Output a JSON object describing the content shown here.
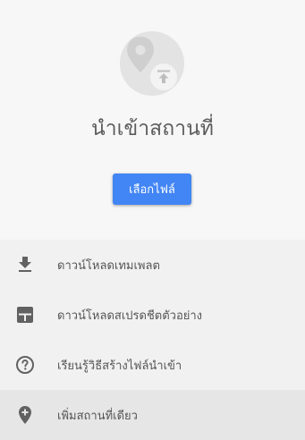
{
  "hero": {
    "illustration_icon": "map-pin-upload-illustration",
    "title": "นำเข้าสถานที่",
    "choose_file_label": "เลือกไฟล์",
    "button_color": "#4285f4"
  },
  "menu": {
    "items": [
      {
        "label": "ดาวน์โหลดเทมเพลต",
        "icon": "download-icon"
      },
      {
        "label": "ดาวน์โหลดสเปรดชีตตัวอย่าง",
        "icon": "spreadsheet-icon"
      },
      {
        "label": "เรียนรู้วิธีสร้างไฟล์นำเข้า",
        "icon": "help-circle-icon"
      },
      {
        "label": "เพิ่มสถานที่เดียว",
        "icon": "add-location-icon"
      }
    ]
  }
}
